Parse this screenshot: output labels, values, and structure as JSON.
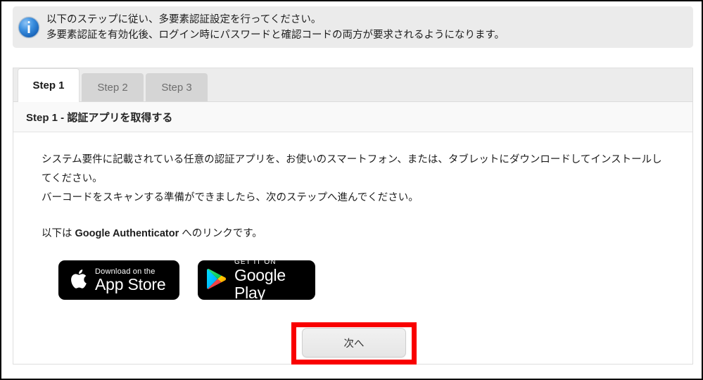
{
  "banner": {
    "icon": "info-icon",
    "line1": "以下のステップに従い、多要素認証設定を行ってください。",
    "line2": "多要素認証を有効化後、ログイン時にパスワードと確認コードの両方が要求されるようになります。"
  },
  "tabs": [
    {
      "label": "Step 1",
      "active": true
    },
    {
      "label": "Step 2",
      "active": false
    },
    {
      "label": "Step 3",
      "active": false
    }
  ],
  "panel": {
    "header": "Step 1 - 認証アプリを取得する",
    "paragraph1": "システム要件に記載されている任意の認証アプリを、お使いのスマートフォン、または、タブレットにダウンロードしてインストールしてください。",
    "paragraph1_line2": "バーコードをスキャンする準備ができましたら、次のステップへ進んでください。",
    "paragraph2_prefix": "以下は ",
    "paragraph2_bold": "Google Authenticator",
    "paragraph2_suffix": " へのリンクです。"
  },
  "badges": {
    "apple": {
      "icon": "apple-logo-icon",
      "small": "Download on the",
      "big": "App Store"
    },
    "google": {
      "icon": "google-play-triangle-icon",
      "small": "GET IT ON",
      "big": "Google Play"
    }
  },
  "next_button": {
    "label": "次へ"
  },
  "annotation": {
    "color": "#f90000"
  },
  "colors": {
    "banner_bg": "#ebebeb",
    "tab_strip_bg": "#ececec",
    "tab_inactive_bg": "#d5d5d5",
    "panel_header_bg": "#f9f9f9",
    "badge_bg": "#000000",
    "highlight": "#f90000"
  }
}
